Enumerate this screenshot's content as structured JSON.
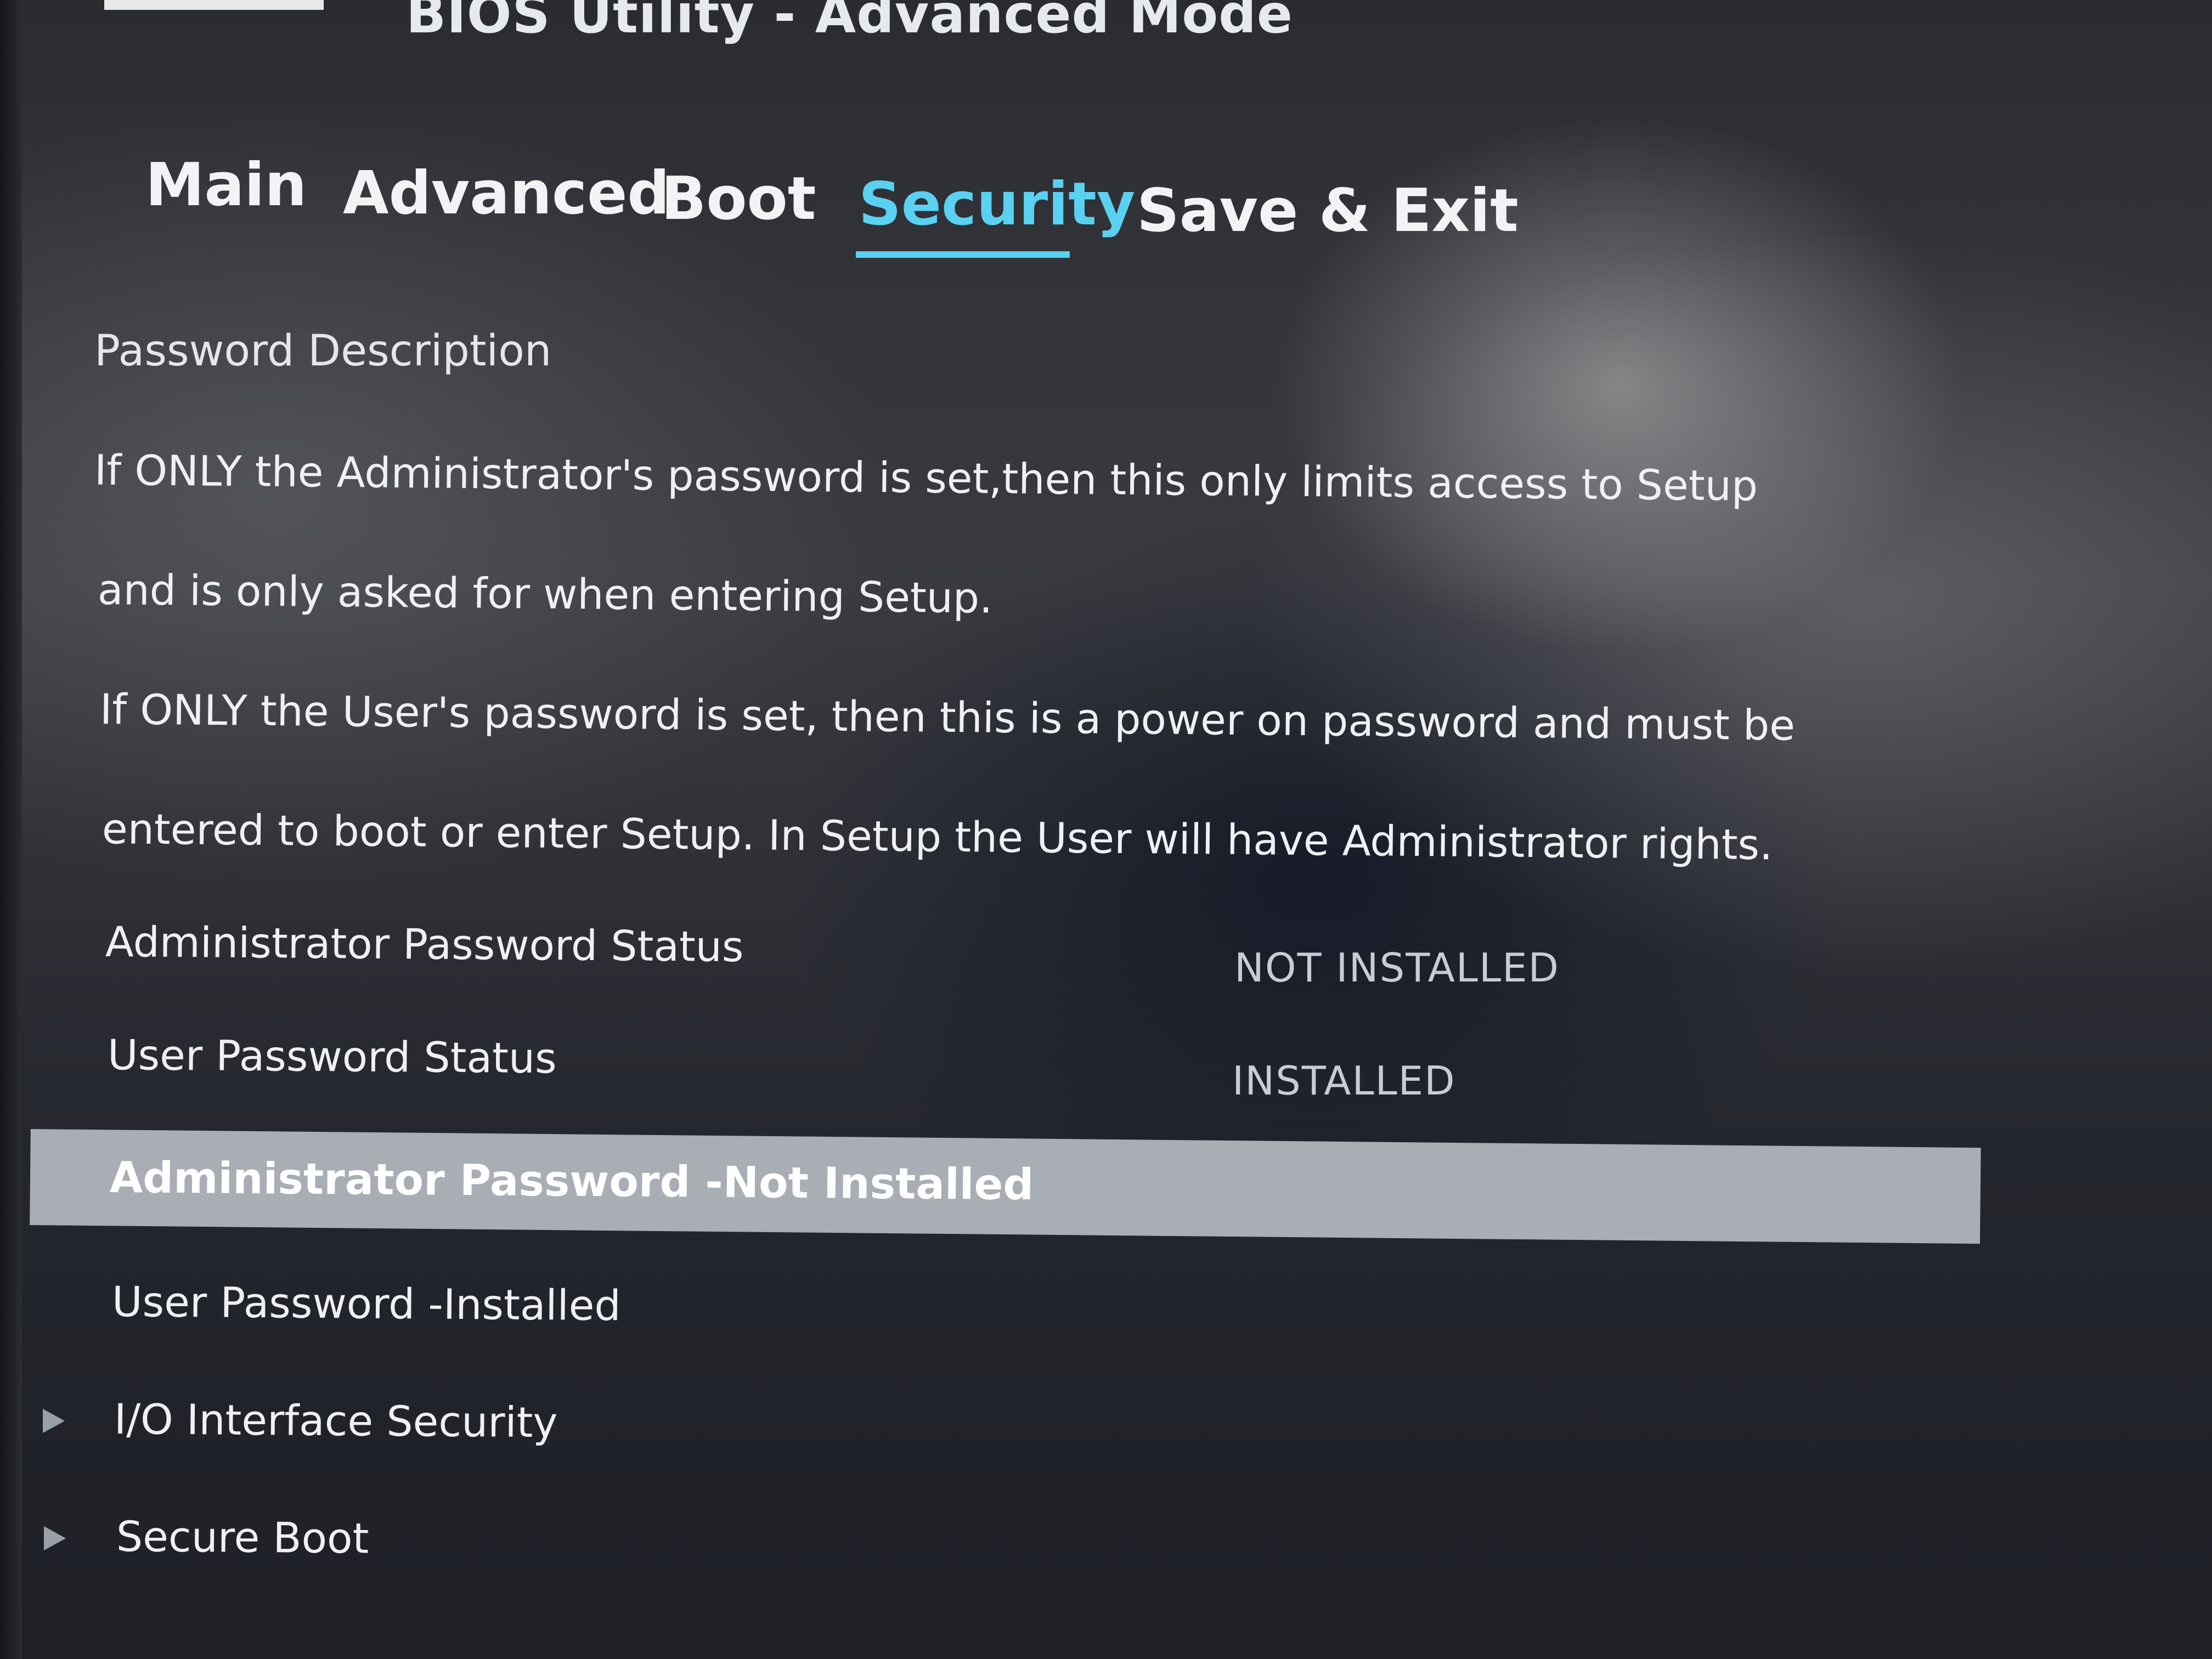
{
  "window": {
    "title": "BIOS Utility - Advanced Mode"
  },
  "tabs": [
    {
      "label": "Main"
    },
    {
      "label": "Advanced"
    },
    {
      "label": "Boot"
    },
    {
      "label": "Security",
      "active": true
    },
    {
      "label": "Save & Exit"
    }
  ],
  "security": {
    "section_title": "Password Description",
    "description_lines": [
      "If ONLY the Administrator's password is set,then this only limits access to Setup",
      "and is only asked for when entering Setup.",
      "If ONLY the User's password is set, then this is a power on password and must be",
      "entered to boot or enter Setup. In Setup the User will have Administrator rights."
    ],
    "status_rows": [
      {
        "label": "Administrator Password Status",
        "value": "NOT INSTALLED"
      },
      {
        "label": "User Password Status",
        "value": "INSTALLED"
      }
    ],
    "menu_items": [
      {
        "label": "Administrator Password -Not Installed",
        "selected": true
      },
      {
        "label": "User Password -Installed"
      },
      {
        "label": "I/O Interface Security",
        "submenu": true
      },
      {
        "label": "Secure Boot",
        "submenu": true
      }
    ]
  },
  "colors": {
    "accent": "#5ad1f0",
    "selection": "#a9adb4",
    "text": "#eef0f3"
  },
  "icons": {
    "submenu": "submenu-arrow-icon"
  }
}
